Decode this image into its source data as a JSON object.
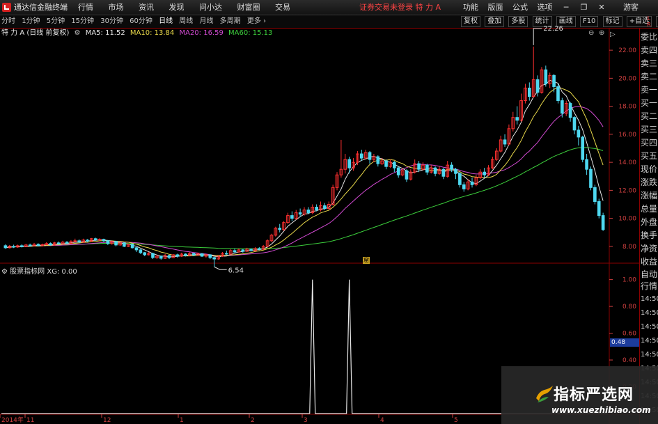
{
  "menubar": {
    "app_title": "通达信金融终端",
    "menus": [
      "行情",
      "市场",
      "资讯",
      "发现",
      "问小达",
      "财富圈",
      "交易"
    ],
    "status": "证券交易未登录 特 力 A",
    "right_items": [
      "功能",
      "版面",
      "公式",
      "选项"
    ],
    "guest": "游客"
  },
  "period_bar": {
    "periods": [
      "分时",
      "1分钟",
      "5分钟",
      "15分钟",
      "30分钟",
      "60分钟",
      "日线",
      "周线",
      "月线",
      "多周期",
      "更多 ›"
    ],
    "active": "日线",
    "tools": [
      "复权",
      "叠加",
      "多股",
      "统计",
      "画线",
      "F10",
      "标记",
      "+自选",
      "返回"
    ]
  },
  "chart_info": {
    "title": "特 力 A (日线 前复权)",
    "ma5": "MA5: 11.52",
    "ma10": "MA10: 13.84",
    "ma20": "MA20: 16.59",
    "ma60": "MA60: 15.13"
  },
  "sub_info": {
    "label": "股票指标网",
    "value": "XG: 0.00"
  },
  "right_badge": "L\nR\n000",
  "right_panel": [
    "委比",
    "卖四",
    "卖三",
    "卖二",
    "卖一",
    "买一",
    "买二",
    "买三",
    "买四",
    "买五",
    "现价",
    "涨跌",
    "涨幅",
    "总量",
    "外盘",
    "换手",
    "净资",
    "收益",
    "自动",
    "行情"
  ],
  "right_times": [
    "14:50",
    "14:50",
    "14:50",
    "14:50",
    "14:50",
    "14:50",
    "14:50",
    "14:50",
    "14:50"
  ],
  "highlight_value": "0.48",
  "marker_note": "窟",
  "watermark": {
    "name": "指标严选网",
    "url": "www.xuezhibiao.com"
  },
  "colors": {
    "up": "#ff3030",
    "down": "#4ed8f0",
    "ma5": "#e6e6e6",
    "ma10": "#e8d84a",
    "ma20": "#d24ad2",
    "ma60": "#3ccf3c",
    "grid": "#8b0000"
  },
  "chart_data": {
    "type": "candlestick",
    "ylim": [
      7.0,
      22.8
    ],
    "y_ticks": [
      "22.00",
      "20.00",
      "18.00",
      "16.00",
      "14.00",
      "12.00",
      "10.00",
      "8.00"
    ],
    "x_labels": [
      "2014年",
      "11",
      "12",
      "1",
      "2",
      "3",
      "4",
      "5"
    ],
    "annotations": {
      "high": "22.26",
      "low": "6.54"
    },
    "indicator": {
      "ylim": [
        0,
        1.05
      ],
      "y_ticks": [
        "1.00",
        "0.80",
        "0.60",
        "0.40",
        "0.20"
      ],
      "spike_days": [
        75,
        84
      ]
    },
    "candles": [
      [
        8.05,
        7.9,
        8.15,
        7.82
      ],
      [
        7.9,
        8.02,
        8.1,
        7.85
      ],
      [
        8.0,
        7.95,
        8.12,
        7.88
      ],
      [
        7.95,
        8.05,
        8.12,
        7.9
      ],
      [
        8.05,
        7.98,
        8.15,
        7.92
      ],
      [
        7.98,
        8.1,
        8.18,
        7.95
      ],
      [
        8.1,
        8.05,
        8.2,
        7.98
      ],
      [
        8.05,
        8.15,
        8.25,
        8.0
      ],
      [
        8.15,
        8.05,
        8.22,
        8.0
      ],
      [
        8.05,
        8.12,
        8.2,
        8.0
      ],
      [
        8.12,
        8.2,
        8.3,
        8.08
      ],
      [
        8.2,
        8.1,
        8.28,
        8.05
      ],
      [
        8.1,
        8.25,
        8.32,
        8.05
      ],
      [
        8.25,
        8.18,
        8.35,
        8.12
      ],
      [
        8.18,
        8.3,
        8.4,
        8.15
      ],
      [
        8.3,
        8.22,
        8.38,
        8.15
      ],
      [
        8.22,
        8.35,
        8.45,
        8.18
      ],
      [
        8.35,
        8.4,
        8.55,
        8.28
      ],
      [
        8.4,
        8.3,
        8.5,
        8.25
      ],
      [
        8.3,
        8.45,
        8.55,
        8.25
      ],
      [
        8.45,
        8.38,
        8.52,
        8.3
      ],
      [
        8.38,
        8.55,
        8.6,
        8.32
      ],
      [
        8.55,
        8.45,
        8.62,
        8.4
      ],
      [
        8.45,
        8.5,
        8.58,
        8.4
      ],
      [
        8.5,
        8.4,
        8.55,
        8.3
      ],
      [
        8.4,
        8.2,
        8.45,
        8.1
      ],
      [
        8.2,
        8.35,
        8.4,
        8.12
      ],
      [
        8.35,
        8.1,
        8.4,
        8.0
      ],
      [
        8.1,
        8.25,
        8.3,
        8.05
      ],
      [
        8.25,
        8.0,
        8.3,
        7.95
      ],
      [
        8.0,
        8.15,
        8.2,
        7.95
      ],
      [
        8.15,
        7.9,
        8.2,
        7.85
      ],
      [
        7.9,
        7.75,
        7.95,
        7.6
      ],
      [
        7.75,
        7.55,
        7.8,
        7.45
      ],
      [
        7.55,
        7.4,
        7.6,
        7.3
      ],
      [
        7.4,
        7.5,
        7.6,
        7.35
      ],
      [
        7.5,
        7.2,
        7.55,
        7.1
      ],
      [
        7.2,
        7.3,
        7.4,
        7.1
      ],
      [
        7.3,
        7.15,
        7.35,
        7.05
      ],
      [
        7.15,
        7.35,
        7.45,
        7.1
      ],
      [
        7.35,
        7.2,
        7.4,
        7.1
      ],
      [
        7.2,
        7.4,
        7.45,
        7.15
      ],
      [
        7.4,
        7.3,
        7.48,
        7.2
      ],
      [
        7.3,
        7.45,
        7.55,
        7.25
      ],
      [
        7.45,
        7.35,
        7.5,
        7.28
      ],
      [
        7.35,
        7.5,
        7.58,
        7.3
      ],
      [
        7.5,
        7.38,
        7.55,
        7.3
      ],
      [
        7.38,
        7.48,
        7.55,
        7.32
      ],
      [
        7.48,
        7.3,
        7.52,
        7.25
      ],
      [
        7.3,
        7.4,
        7.45,
        7.2
      ],
      [
        7.4,
        7.2,
        7.45,
        7.1
      ],
      [
        7.2,
        7.1,
        7.25,
        6.54
      ],
      [
        7.1,
        7.3,
        7.35,
        7.05
      ],
      [
        7.3,
        7.5,
        7.6,
        7.25
      ],
      [
        7.5,
        7.45,
        7.7,
        7.4
      ],
      [
        7.45,
        7.7,
        7.8,
        7.4
      ],
      [
        7.7,
        7.6,
        7.85,
        7.55
      ],
      [
        7.6,
        7.75,
        7.85,
        7.55
      ],
      [
        7.75,
        7.65,
        7.8,
        7.55
      ],
      [
        7.65,
        7.8,
        7.9,
        7.6
      ],
      [
        7.8,
        7.7,
        7.85,
        7.62
      ],
      [
        7.7,
        7.85,
        7.95,
        7.65
      ],
      [
        7.85,
        7.8,
        7.95,
        7.72
      ],
      [
        7.8,
        8.0,
        8.1,
        7.75
      ],
      [
        8.0,
        8.4,
        8.5,
        7.95
      ],
      [
        8.4,
        8.8,
        8.9,
        8.3
      ],
      [
        8.8,
        9.3,
        9.4,
        8.7
      ],
      [
        9.3,
        9.2,
        9.6,
        9.0
      ],
      [
        9.2,
        9.7,
        9.8,
        9.1
      ],
      [
        9.7,
        10.2,
        10.4,
        9.6
      ],
      [
        10.2,
        10.0,
        10.5,
        9.8
      ],
      [
        10.0,
        10.4,
        10.6,
        9.9
      ],
      [
        10.4,
        10.3,
        10.7,
        10.1
      ],
      [
        10.3,
        10.6,
        10.8,
        10.2
      ],
      [
        10.6,
        10.4,
        10.8,
        10.3
      ],
      [
        10.4,
        10.8,
        11.0,
        10.3
      ],
      [
        10.8,
        10.6,
        11.0,
        10.5
      ],
      [
        10.6,
        10.9,
        11.2,
        10.5
      ],
      [
        10.9,
        10.7,
        11.1,
        10.6
      ],
      [
        10.7,
        11.0,
        11.2,
        10.6
      ],
      [
        11.0,
        12.2,
        12.4,
        10.9
      ],
      [
        12.2,
        13.1,
        13.3,
        12.0
      ],
      [
        13.1,
        13.5,
        15.6,
        12.9
      ],
      [
        13.5,
        14.2,
        14.6,
        13.2
      ],
      [
        14.2,
        13.6,
        14.4,
        13.2
      ],
      [
        13.6,
        14.0,
        14.3,
        13.4
      ],
      [
        14.0,
        14.6,
        14.8,
        13.8
      ],
      [
        14.6,
        14.3,
        14.9,
        14.1
      ],
      [
        14.3,
        14.7,
        14.9,
        14.2
      ],
      [
        14.7,
        14.2,
        14.8,
        13.9
      ],
      [
        14.2,
        14.4,
        14.6,
        14.0
      ],
      [
        14.4,
        13.9,
        14.5,
        13.7
      ],
      [
        13.9,
        14.1,
        14.3,
        13.8
      ],
      [
        14.1,
        13.7,
        14.2,
        13.5
      ],
      [
        13.7,
        14.0,
        14.2,
        13.6
      ],
      [
        14.0,
        13.6,
        14.1,
        13.3
      ],
      [
        13.6,
        13.1,
        13.7,
        12.9
      ],
      [
        13.1,
        13.4,
        13.6,
        13.0
      ],
      [
        13.4,
        12.8,
        13.5,
        12.6
      ],
      [
        12.8,
        13.3,
        13.5,
        12.7
      ],
      [
        13.3,
        13.9,
        14.2,
        13.2
      ],
      [
        13.9,
        13.5,
        14.1,
        13.3
      ],
      [
        13.5,
        13.8,
        14.0,
        13.4
      ],
      [
        13.8,
        13.3,
        13.9,
        13.1
      ],
      [
        13.3,
        13.6,
        13.8,
        13.2
      ],
      [
        13.6,
        13.2,
        13.7,
        13.0
      ],
      [
        13.2,
        13.5,
        13.7,
        13.1
      ],
      [
        13.5,
        13.0,
        13.6,
        12.8
      ],
      [
        13.0,
        13.8,
        14.1,
        12.9
      ],
      [
        13.8,
        13.5,
        14.0,
        13.3
      ],
      [
        13.5,
        13.2,
        13.6,
        12.8
      ],
      [
        13.2,
        12.4,
        13.3,
        12.2
      ],
      [
        12.4,
        12.1,
        12.6,
        11.9
      ],
      [
        12.1,
        12.6,
        12.8,
        12.0
      ],
      [
        12.6,
        12.4,
        12.9,
        12.2
      ],
      [
        12.4,
        12.9,
        13.1,
        12.3
      ],
      [
        12.9,
        13.3,
        13.5,
        12.8
      ],
      [
        13.3,
        13.1,
        13.6,
        12.9
      ],
      [
        13.1,
        13.6,
        13.8,
        13.0
      ],
      [
        13.6,
        14.2,
        14.4,
        13.5
      ],
      [
        14.2,
        14.8,
        15.0,
        14.1
      ],
      [
        14.8,
        15.6,
        15.9,
        14.7
      ],
      [
        15.6,
        15.3,
        16.0,
        15.1
      ],
      [
        15.3,
        16.4,
        16.7,
        15.2
      ],
      [
        16.4,
        17.2,
        17.6,
        16.2
      ],
      [
        17.2,
        17.0,
        18.0,
        16.7
      ],
      [
        17.0,
        18.4,
        18.9,
        16.9
      ],
      [
        18.4,
        19.3,
        19.6,
        18.2
      ],
      [
        19.3,
        18.7,
        19.7,
        18.4
      ],
      [
        18.7,
        19.9,
        22.26,
        18.6
      ],
      [
        19.9,
        19.0,
        20.2,
        18.7
      ],
      [
        19.0,
        20.6,
        20.8,
        18.9
      ],
      [
        20.6,
        19.6,
        20.9,
        19.4
      ],
      [
        19.6,
        20.2,
        20.4,
        19.3
      ],
      [
        20.2,
        19.4,
        20.3,
        19.0
      ],
      [
        19.4,
        18.4,
        19.6,
        18.2
      ],
      [
        18.4,
        17.5,
        18.6,
        17.2
      ],
      [
        17.5,
        18.2,
        18.4,
        17.3
      ],
      [
        18.2,
        17.2,
        18.3,
        16.9
      ],
      [
        17.2,
        16.3,
        17.3,
        16.0
      ],
      [
        16.3,
        15.8,
        16.6,
        15.2
      ],
      [
        15.8,
        14.2,
        15.9,
        14.0
      ],
      [
        14.2,
        13.5,
        14.6,
        13.1
      ],
      [
        13.5,
        12.2,
        13.7,
        12.0
      ],
      [
        12.2,
        11.2,
        12.4,
        11.0
      ],
      [
        11.2,
        10.2,
        11.4,
        10.0
      ],
      [
        10.2,
        9.2,
        10.4,
        9.1
      ]
    ]
  }
}
